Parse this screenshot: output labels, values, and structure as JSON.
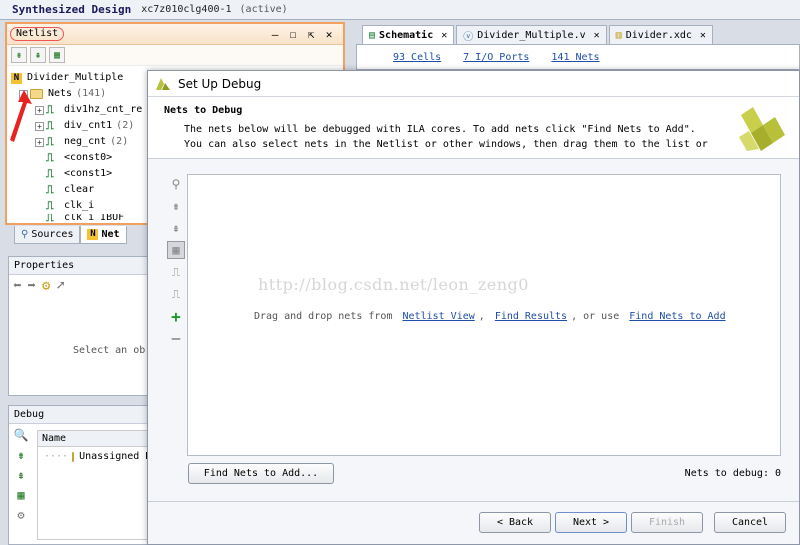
{
  "main_title": {
    "design": "Synthesized Design",
    "part": "xc7z010clg400-1",
    "status": "(active)"
  },
  "netlist": {
    "title": "Netlist",
    "root": "Divider_Multiple",
    "nets_label": "Nets",
    "nets_count": "(141)",
    "items": [
      {
        "label": "div1hz_cnt_re",
        "count": ""
      },
      {
        "label": "div_cnt1",
        "count": "(2)"
      },
      {
        "label": "neg_cnt",
        "count": "(2)"
      },
      {
        "label": "<const0>",
        "count": ""
      },
      {
        "label": "<const1>",
        "count": ""
      },
      {
        "label": "clear",
        "count": ""
      },
      {
        "label": "clk_i",
        "count": ""
      },
      {
        "label": "clk_i_IBUF",
        "count": ""
      }
    ]
  },
  "left_tabs": {
    "sources": "Sources",
    "netlist": "Net"
  },
  "properties": {
    "title": "Properties",
    "empty_text": "Select an ob"
  },
  "debug": {
    "title": "Debug",
    "col_name": "Name",
    "row_label": "Unassigned D"
  },
  "editor_tabs": [
    {
      "label": "Schematic",
      "active": true
    },
    {
      "label": "Divider_Multiple.v",
      "active": false
    },
    {
      "label": "Divider.xdc",
      "active": false
    }
  ],
  "editor_bar": {
    "cells": "93 Cells",
    "ports": "7 I/O Ports",
    "nets": "141 Nets"
  },
  "dialog": {
    "title": "Set Up Debug",
    "heading": "Nets to Debug",
    "desc_line1": "The nets below will be debugged with ILA cores. To add nets click \"Find Nets to Add\".",
    "desc_line2": "You can also select nets in the Netlist or other windows, then drag them to the list or",
    "watermark": "http://blog.csdn.net/leon_zeng0",
    "drop_prefix": "Drag and drop nets from",
    "link_netlist": "Netlist View",
    "link_results": "Find Results",
    "drop_or": "or use",
    "link_find": "Find Nets to Add",
    "find_button": "Find Nets to Add...",
    "nets_count_label": "Nets to debug: 0",
    "btn_back": "< Back",
    "btn_next": "Next >",
    "btn_finish": "Finish",
    "btn_cancel": "Cancel"
  },
  "colors": {
    "accent_orange": "#f2a060",
    "link_blue": "#1f4fa8",
    "add_green": "#1c9a2c"
  }
}
